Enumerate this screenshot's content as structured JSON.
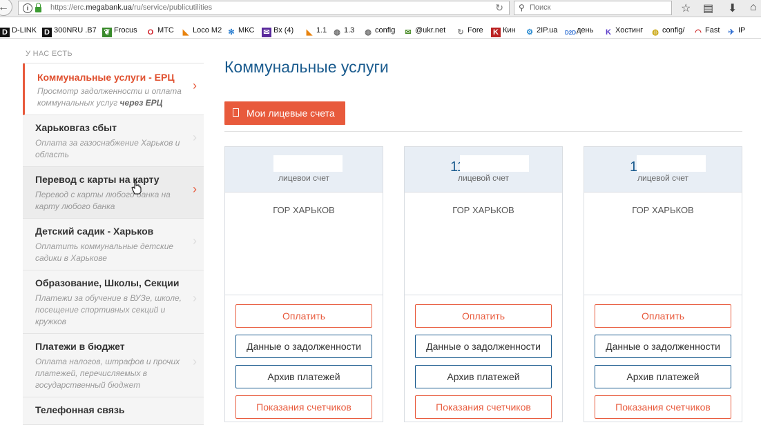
{
  "browser": {
    "url_prefix": "https://erc.",
    "url_host": "megabank.ua",
    "url_path": "/ru/service/publicutilities",
    "search_placeholder": "Поиск"
  },
  "bookmarks": [
    {
      "label": "D-LINK",
      "icon": "dlink-icon"
    },
    {
      "label": "300NRU .B7",
      "icon": "dlink-icon"
    },
    {
      "label": "Frocus",
      "icon": "leaf-icon"
    },
    {
      "label": "МТС",
      "icon": "opera-icon"
    },
    {
      "label": "Loco M2",
      "icon": "rss-icon"
    },
    {
      "label": "МКС",
      "icon": "snowflake-icon"
    },
    {
      "label": "Вх (4)",
      "icon": "mail-icon"
    },
    {
      "label": "1.1",
      "icon": "rss-icon"
    },
    {
      "label": "1.3",
      "icon": "globe-icon"
    },
    {
      "label": "config",
      "icon": "globe-icon"
    },
    {
      "label": "@ukr.net",
      "icon": "envelope-icon"
    },
    {
      "label": "Fore",
      "icon": "refresh-icon"
    },
    {
      "label": "Кин",
      "icon": "k-icon"
    },
    {
      "label": "2IP.ua",
      "icon": "gear-icon"
    },
    {
      "label": "день",
      "icon": "d2d-icon"
    },
    {
      "label": "Хостинг",
      "icon": "k-icon"
    },
    {
      "label": "config/",
      "icon": "globe-icon"
    },
    {
      "label": "Fast",
      "icon": "gauge-icon"
    },
    {
      "label": "IP",
      "icon": "plane-icon"
    }
  ],
  "sidebar": {
    "heading": "У НАС ЕСТЬ",
    "items": [
      {
        "title": "Коммунальные услуги - ЕРЦ",
        "desc": "Просмотр задолженности и оплата коммунальных услуг ",
        "desc_bold": "через ЕРЦ"
      },
      {
        "title": "Харьковгаз сбыт",
        "desc": "Оплата за газоснабжение Харьков и область"
      },
      {
        "title": "Перевод с карты на карту",
        "desc": "Перевод с карты любого банка на карту любого банка"
      },
      {
        "title": "Детский садик - Харьков",
        "desc": "Оплатить коммунальные детские садики в Харькове"
      },
      {
        "title": "Образование, Школы, Секции",
        "desc": "Платежи за обучение в ВУЗе, школе, посещение спортивных секций и кружков"
      },
      {
        "title": "Платежи в бюджет",
        "desc": "Оплата налогов, штрафов и прочих платежей, перечисляемых в государственный бюджет"
      },
      {
        "title": "Телефонная связь",
        "desc": ""
      }
    ]
  },
  "main": {
    "title": "Коммунальные услуги",
    "accounts_button": "Мои лицевые счета",
    "cards": [
      {
        "number": "",
        "label": "лицевои счет",
        "city": "ГОР ХАРЬКОВ"
      },
      {
        "number": "11",
        "label": "лицевой счет",
        "city": "ГОР ХАРЬКОВ"
      },
      {
        "number": "1",
        "label": "лицевой счет",
        "city": "ГОР ХАРЬКОВ"
      }
    ],
    "buttons": {
      "pay": "Оплатить",
      "debt": "Данные о задолженности",
      "archive": "Архив платежей",
      "meters": "Показания счетчиков"
    }
  },
  "colors": {
    "accent": "#e85a3c",
    "brand_blue": "#1a5b8e"
  }
}
